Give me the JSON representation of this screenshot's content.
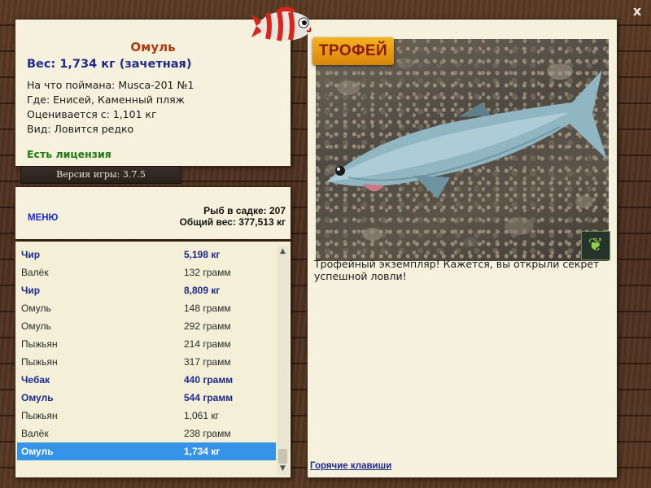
{
  "close_label": "x",
  "fish_info": {
    "title": "Омуль",
    "weight": "Вес: 1,734 кг (зачетная)",
    "caught_on": "На что поймана: Musca-201 №1",
    "location": "Где: Енисей, Каменный пляж",
    "estimated": "Оценивается с: 1,101 кг",
    "rarity": "Вид: Ловится редко",
    "license": "Есть лицензия"
  },
  "version": "Версия игры: 3.7.5",
  "menu_label": "МЕНЮ",
  "stats": {
    "fish_count": "Рыб в садке: 207",
    "total_weight": "Общий вес: 377,513 кг"
  },
  "catch_list": [
    {
      "name": "Чир",
      "weight": "5,198 кг",
      "bold": true
    },
    {
      "name": "Валёк",
      "weight": "132 грамм",
      "bold": false
    },
    {
      "name": "Чир",
      "weight": "8,809 кг",
      "bold": true
    },
    {
      "name": "Омуль",
      "weight": "148 грамм",
      "bold": false
    },
    {
      "name": "Омуль",
      "weight": "292 грамм",
      "bold": false
    },
    {
      "name": "Пыжьян",
      "weight": "214 грамм",
      "bold": false
    },
    {
      "name": "Пыжьян",
      "weight": "317 грамм",
      "bold": false
    },
    {
      "name": "Чебак",
      "weight": "440 грамм",
      "bold": true
    },
    {
      "name": "Омуль",
      "weight": "544 грамм",
      "bold": true
    },
    {
      "name": "Пыжьян",
      "weight": "1,061 кг",
      "bold": false
    },
    {
      "name": "Валёк",
      "weight": "238 грамм",
      "bold": false
    },
    {
      "name": "Омуль",
      "weight": "1,734 кг",
      "bold": true,
      "selected": true
    }
  ],
  "trophy_badge": "ТРОФЕЙ",
  "description": "Трофейный экземпляр! Кажется, вы открыли секрет успешной ловли!",
  "hotkeys_label": "Горячие клавиши",
  "icons": {
    "butterfly": "butterfly-icon",
    "close": "close-icon",
    "mascot": "fish-mascot-icon"
  },
  "colors": {
    "title": "#b03a12",
    "weight": "#1d2a8c",
    "license": "#1f7a12",
    "selected_row": "#3593e8",
    "trophy_badge": "#f4b21e"
  }
}
